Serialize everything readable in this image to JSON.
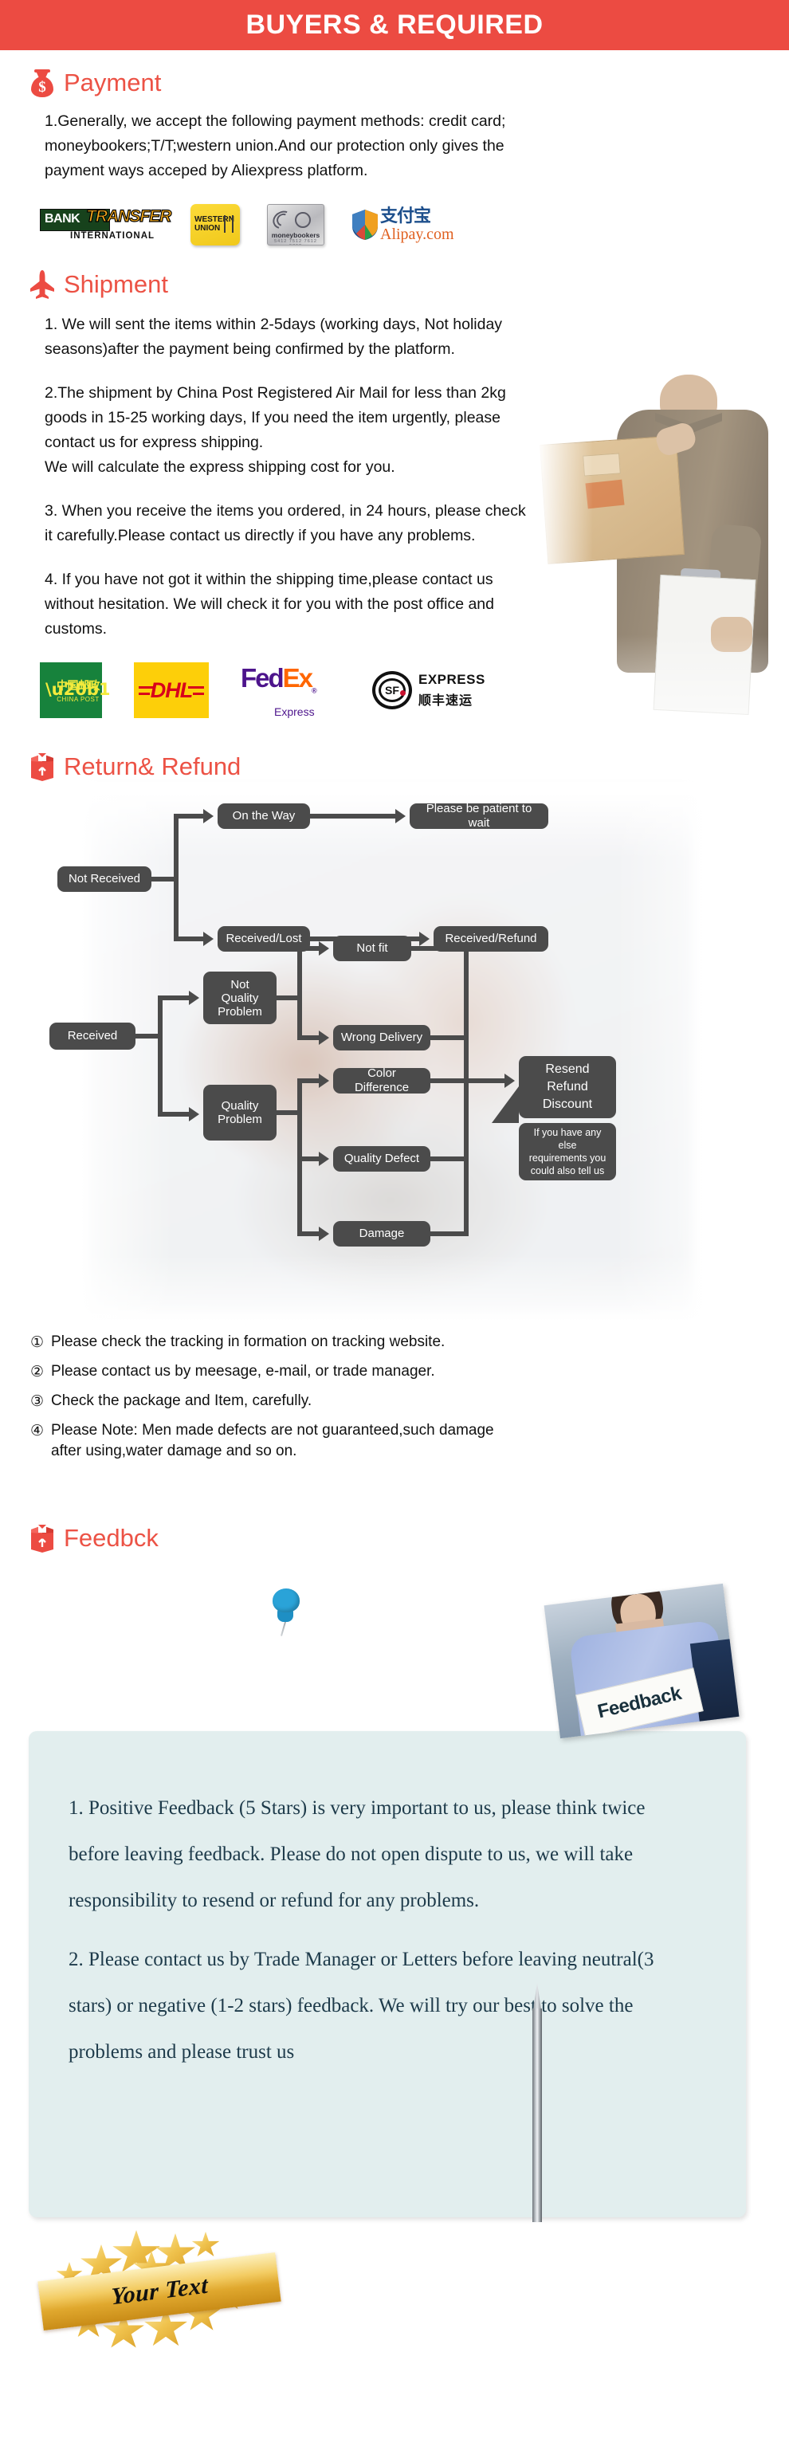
{
  "header": {
    "title": "BUYERS & REQUIRED",
    "bg_color": "#ec4b42",
    "text_color": "#ffffff"
  },
  "accent_color": "#ec5245",
  "sections": {
    "payment": {
      "icon": "money-bag-icon",
      "heading": "Payment",
      "body": "1.Generally, we accept the following payment methods: credit card;\nmoneybookers;T/T;western union.And our protection only gives the\npayment ways acceped by Aliexpress platform.",
      "logos": [
        {
          "name": "bank-transfer-logo",
          "line1": "BANK",
          "line2": "TRANSFER",
          "line3": "INTERNATIONAL"
        },
        {
          "name": "western-union-logo",
          "line1": "WESTERN",
          "line2": "UNION"
        },
        {
          "name": "moneybookers-logo",
          "line1": "moneybookers",
          "line2": "5412 7512   7612 0792"
        },
        {
          "name": "alipay-logo",
          "line1": "支付宝",
          "line2": "Alipay.com"
        }
      ]
    },
    "shipment": {
      "icon": "airplane-icon",
      "heading": "Shipment",
      "paragraphs": [
        "1. We will sent the items within 2-5days (working days, Not holiday\nseasons)after the payment being confirmed by the platform.",
        "2.The shipment by China Post Registered Air Mail for less than  2kg\ngoods in 15-25 working days, If  you need the item urgently, please\ncontact us for express shipping.\nWe will calculate the express shipping cost for you.",
        "3. When you receive the items you ordered, in 24 hours, please check\n it carefully.Please contact us directly if you have any problems.",
        "4. If you have not got it within the shipping time,please contact us\nwithout hesitation. We will check it for you with the post office and\ncustoms."
      ],
      "logos": [
        {
          "name": "china-post-logo",
          "line1": "中国邮政",
          "line2": "CHINA POST"
        },
        {
          "name": "dhl-logo",
          "line1": "DHL"
        },
        {
          "name": "fedex-logo",
          "line1": "Fed",
          "line2": "Ex",
          "line3": "Express"
        },
        {
          "name": "sf-express-logo",
          "line1": "SF",
          "line2": "EXPRESS",
          "line3": "顺丰速运"
        }
      ],
      "photo_alt": "courier holding parcel"
    },
    "return_refund": {
      "icon": "return-box-icon",
      "heading": "Return& Refund",
      "flowchart": {
        "box_color": "#4b4b4b",
        "text_color": "#ffffff",
        "nodes": {
          "not_received": "Not Received",
          "on_the_way": "On the Way",
          "please_wait": "Please be patient to wait",
          "received_lost": "Received/Lost",
          "received_refund": "Received/Refund",
          "received": "Received",
          "not_quality_problem": "Not\nQuality\nProblem",
          "quality_problem": "Quality\nProblem",
          "not_fit": "Not fit",
          "wrong_delivery": "Wrong Delivery",
          "color_difference": "Color Difference",
          "quality_defect": "Quality Defect",
          "damage": "Damage",
          "resend_refund_discount": "Resend\nRefund\nDiscount",
          "callout": "If you have any else\nrequirements you\ncould also tell us"
        }
      },
      "notes": [
        {
          "num": "①",
          "text": "Please check the tracking in formation on tracking website."
        },
        {
          "num": "②",
          "text": "Please contact us by meesage, e-mail, or trade manager."
        },
        {
          "num": "③",
          "text": "Check the package and Item, carefully."
        },
        {
          "num": "④",
          "text": "Please Note: Men made defects  are not guaranteed,such damage\n   after using,water damage and so on."
        }
      ]
    },
    "feedback": {
      "icon": "return-box-icon",
      "heading": "Feedbck",
      "photo_sign_text": "Feedback",
      "pin": "pushpin-icon",
      "box_color": "#e2eeee",
      "text_color": "#1d3a4a",
      "paragraphs": [
        "1. Positive Feedback (5 Stars) is very important to us, please think twice before leaving feedback. Please do not open dispute to us,   we will take responsibility to resend or refund for any problems.",
        "2. Please contact us by Trade Manager or Letters before leaving neutral(3 stars) or negative (1-2 stars) feedback. We will try our best to solve the problems and please trust us"
      ],
      "badge_text": "Your Text"
    }
  }
}
